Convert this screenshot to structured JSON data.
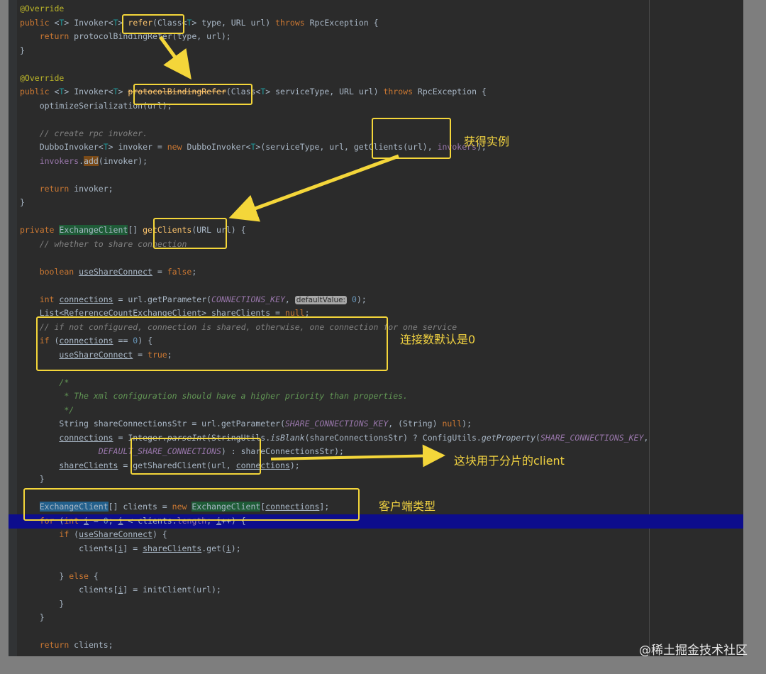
{
  "editor": {
    "lines": [
      [
        {
          "t": "@Override",
          "c": "ann"
        }
      ],
      [
        {
          "t": "public ",
          "c": "kw"
        },
        {
          "t": "<",
          "c": "p"
        },
        {
          "t": "T",
          "c": "tp"
        },
        {
          "t": "> Invoker<",
          "c": "type"
        },
        {
          "t": "T",
          "c": "tp"
        },
        {
          "t": "> ",
          "c": "p"
        },
        {
          "t": "refer",
          "c": "fn"
        },
        {
          "t": "(Class<",
          "c": "p"
        },
        {
          "t": "T",
          "c": "tp"
        },
        {
          "t": "> type, URL url) ",
          "c": "p"
        },
        {
          "t": "throws ",
          "c": "kw"
        },
        {
          "t": "RpcException {",
          "c": "p"
        }
      ],
      [
        {
          "t": "    ",
          "c": "p"
        },
        {
          "t": "return ",
          "c": "kw"
        },
        {
          "t": "protocolBindingRefer(type, url);",
          "c": "p"
        }
      ],
      [
        {
          "t": "}",
          "c": "p"
        }
      ],
      [
        {
          "t": "",
          "c": "p"
        }
      ],
      [
        {
          "t": "@Override",
          "c": "ann"
        }
      ],
      [
        {
          "t": "public ",
          "c": "kw"
        },
        {
          "t": "<",
          "c": "p"
        },
        {
          "t": "T",
          "c": "tp"
        },
        {
          "t": "> Invoker<",
          "c": "type"
        },
        {
          "t": "T",
          "c": "tp"
        },
        {
          "t": "> ",
          "c": "p"
        },
        {
          "t": "protocolBindingRefer",
          "c": "strike"
        },
        {
          "t": "(Class<",
          "c": "p"
        },
        {
          "t": "T",
          "c": "tp"
        },
        {
          "t": "> serviceType, URL url) ",
          "c": "p"
        },
        {
          "t": "throws ",
          "c": "kw"
        },
        {
          "t": "RpcException {",
          "c": "p"
        }
      ],
      [
        {
          "t": "    optimizeSerialization(url);",
          "c": "p"
        }
      ],
      [
        {
          "t": "",
          "c": "p"
        }
      ],
      [
        {
          "t": "    ",
          "c": "p"
        },
        {
          "t": "// create rpc invoker.",
          "c": "cm"
        }
      ],
      [
        {
          "t": "    DubboInvoker<",
          "c": "p"
        },
        {
          "t": "T",
          "c": "tp"
        },
        {
          "t": "> invoker = ",
          "c": "p"
        },
        {
          "t": "new ",
          "c": "kw"
        },
        {
          "t": "DubboInvoker<",
          "c": "p"
        },
        {
          "t": "T",
          "c": "tp"
        },
        {
          "t": ">(serviceType, url, getClients(url), ",
          "c": "p"
        },
        {
          "t": "invokers",
          "c": "field"
        },
        {
          "t": ");",
          "c": "p"
        }
      ],
      [
        {
          "t": "    ",
          "c": "p"
        },
        {
          "t": "invokers",
          "c": "field"
        },
        {
          "t": ".",
          "c": "p"
        },
        {
          "t": "add",
          "c": "mark"
        },
        {
          "t": "(invoker);",
          "c": "p"
        }
      ],
      [
        {
          "t": "",
          "c": "p"
        }
      ],
      [
        {
          "t": "    ",
          "c": "p"
        },
        {
          "t": "return ",
          "c": "kw"
        },
        {
          "t": "invoker;",
          "c": "p"
        }
      ],
      [
        {
          "t": "}",
          "c": "p"
        }
      ],
      [
        {
          "t": "",
          "c": "p"
        }
      ],
      [
        {
          "t": "private ",
          "c": "kw"
        },
        {
          "t": "ExchangeClient",
          "c": "hl"
        },
        {
          "t": "[] ",
          "c": "p"
        },
        {
          "t": "getClients",
          "c": "fn"
        },
        {
          "t": "(URL url) {",
          "c": "p"
        }
      ],
      [
        {
          "t": "    ",
          "c": "p"
        },
        {
          "t": "// whether to share connection",
          "c": "cm"
        }
      ],
      [
        {
          "t": "",
          "c": "p"
        }
      ],
      [
        {
          "t": "    ",
          "c": "p"
        },
        {
          "t": "boolean ",
          "c": "kw"
        },
        {
          "t": "useShareConnect",
          "c": "ul"
        },
        {
          "t": " = ",
          "c": "p"
        },
        {
          "t": "false",
          "c": "kw"
        },
        {
          "t": ";",
          "c": "p"
        }
      ],
      [
        {
          "t": "",
          "c": "p"
        }
      ],
      [
        {
          "t": "    ",
          "c": "p"
        },
        {
          "t": "int ",
          "c": "kw"
        },
        {
          "t": "connections",
          "c": "ul"
        },
        {
          "t": " = url.getParameter(",
          "c": "p"
        },
        {
          "t": "CONNECTIONS_KEY",
          "c": "const"
        },
        {
          "t": ", ",
          "c": "p"
        },
        {
          "t": "defaultValue:",
          "c": "hint"
        },
        {
          "t": " ",
          "c": "p"
        },
        {
          "t": "0",
          "c": "num"
        },
        {
          "t": ");",
          "c": "p"
        }
      ],
      [
        {
          "t": "    List<ReferenceCountExchangeClient> ",
          "c": "p"
        },
        {
          "t": "shareClients",
          "c": "ul"
        },
        {
          "t": " = ",
          "c": "p"
        },
        {
          "t": "null",
          "c": "kw"
        },
        {
          "t": ";",
          "c": "p"
        }
      ],
      [
        {
          "t": "    ",
          "c": "p"
        },
        {
          "t": "// if not configured, connection is shared, otherwise, one connection for one service",
          "c": "cm"
        }
      ],
      [
        {
          "t": "    ",
          "c": "p"
        },
        {
          "t": "if ",
          "c": "kw"
        },
        {
          "t": "(",
          "c": "p"
        },
        {
          "t": "connections",
          "c": "ul"
        },
        {
          "t": " == ",
          "c": "p"
        },
        {
          "t": "0",
          "c": "num"
        },
        {
          "t": ") {",
          "c": "p"
        }
      ],
      [
        {
          "t": "        ",
          "c": "p"
        },
        {
          "t": "useShareConnect",
          "c": "ul"
        },
        {
          "t": " = ",
          "c": "p"
        },
        {
          "t": "true",
          "c": "kw"
        },
        {
          "t": ";",
          "c": "p"
        }
      ],
      [
        {
          "t": "",
          "c": "p"
        }
      ],
      [
        {
          "t": "        ",
          "c": "p"
        },
        {
          "t": "/*",
          "c": "cmb"
        }
      ],
      [
        {
          "t": "         ",
          "c": "p"
        },
        {
          "t": "* The xml configuration should have a higher priority than properties.",
          "c": "cmb"
        }
      ],
      [
        {
          "t": "         ",
          "c": "p"
        },
        {
          "t": "*/",
          "c": "cmb"
        }
      ],
      [
        {
          "t": "        String shareConnectionsStr = url.getParameter(",
          "c": "p"
        },
        {
          "t": "SHARE_CONNECTIONS_KEY",
          "c": "const"
        },
        {
          "t": ", (String) ",
          "c": "p"
        },
        {
          "t": "null",
          "c": "kw"
        },
        {
          "t": ");",
          "c": "p"
        }
      ],
      [
        {
          "t": "        ",
          "c": "p"
        },
        {
          "t": "connections",
          "c": "ul"
        },
        {
          "t": " = Integer.",
          "c": "p"
        },
        {
          "t": "parseInt",
          "c": "st"
        },
        {
          "t": "(StringUtils.",
          "c": "p"
        },
        {
          "t": "isBlank",
          "c": "st"
        },
        {
          "t": "(shareConnectionsStr) ? ConfigUtils.",
          "c": "p"
        },
        {
          "t": "getProperty",
          "c": "st"
        },
        {
          "t": "(",
          "c": "p"
        },
        {
          "t": "SHARE_CONNECTIONS_KEY",
          "c": "const"
        },
        {
          "t": ",",
          "c": "p"
        }
      ],
      [
        {
          "t": "                ",
          "c": "p"
        },
        {
          "t": "DEFAULT_SHARE_CONNECTIONS",
          "c": "const"
        },
        {
          "t": ") : shareConnectionsStr);",
          "c": "p"
        }
      ],
      [
        {
          "t": "        ",
          "c": "p"
        },
        {
          "t": "shareClients",
          "c": "ul"
        },
        {
          "t": " = getSharedClient(url, ",
          "c": "p"
        },
        {
          "t": "connections",
          "c": "ul"
        },
        {
          "t": ");",
          "c": "p"
        }
      ],
      [
        {
          "t": "    }",
          "c": "p"
        }
      ],
      [
        {
          "t": "",
          "c": "p"
        }
      ],
      [
        {
          "t": "    ",
          "c": "p"
        },
        {
          "t": "ExchangeClient",
          "c": "hl2"
        },
        {
          "t": "[] clients = ",
          "c": "p"
        },
        {
          "t": "new ",
          "c": "kw"
        },
        {
          "t": "ExchangeClient",
          "c": "hl"
        },
        {
          "t": "[",
          "c": "p"
        },
        {
          "t": "connections",
          "c": "ul"
        },
        {
          "t": "];",
          "c": "p"
        }
      ],
      [
        {
          "t": "    ",
          "c": "p"
        },
        {
          "t": "for ",
          "c": "kw"
        },
        {
          "t": "(",
          "c": "p"
        },
        {
          "t": "int ",
          "c": "kw"
        },
        {
          "t": "i",
          "c": "ul"
        },
        {
          "t": " = ",
          "c": "p"
        },
        {
          "t": "0",
          "c": "num"
        },
        {
          "t": "; ",
          "c": "p"
        },
        {
          "t": "i",
          "c": "ul"
        },
        {
          "t": " < clients.",
          "c": "p"
        },
        {
          "t": "length",
          "c": "field"
        },
        {
          "t": "; ",
          "c": "p"
        },
        {
          "t": "i",
          "c": "ul"
        },
        {
          "t": "++) {",
          "c": "p"
        }
      ],
      [
        {
          "t": "        ",
          "c": "p"
        },
        {
          "t": "if ",
          "c": "kw"
        },
        {
          "t": "(",
          "c": "p"
        },
        {
          "t": "useShareConnect",
          "c": "ul"
        },
        {
          "t": ") {",
          "c": "p"
        }
      ],
      [
        {
          "t": "            clients[",
          "c": "p"
        },
        {
          "t": "i",
          "c": "ul"
        },
        {
          "t": "] = ",
          "c": "p"
        },
        {
          "t": "shareClients",
          "c": "ul"
        },
        {
          "t": ".get(",
          "c": "p"
        },
        {
          "t": "i",
          "c": "ul"
        },
        {
          "t": ");",
          "c": "p"
        }
      ],
      [
        {
          "t": "",
          "c": "p"
        }
      ],
      [
        {
          "t": "        } ",
          "c": "p"
        },
        {
          "t": "else ",
          "c": "kw"
        },
        {
          "t": "{",
          "c": "p"
        }
      ],
      [
        {
          "t": "            clients[",
          "c": "p"
        },
        {
          "t": "i",
          "c": "ul"
        },
        {
          "t": "] = initClient(url);",
          "c": "p"
        }
      ],
      [
        {
          "t": "        }",
          "c": "p"
        }
      ],
      [
        {
          "t": "    }",
          "c": "p"
        }
      ],
      [
        {
          "t": "",
          "c": "p"
        }
      ],
      [
        {
          "t": "    ",
          "c": "p"
        },
        {
          "t": "return ",
          "c": "kw"
        },
        {
          "t": "clients;",
          "c": "p"
        }
      ]
    ],
    "highlighted_line": 37
  },
  "annotations": {
    "get_instance": "获得实例",
    "default_connections": "连接数默认是0",
    "sharded_client": "这块用于分片的client",
    "client_type": "客户端类型"
  },
  "watermark": "@稀土掘金技术社区",
  "colors": {
    "editor_bg": "#2b2b2b",
    "accent_yellow": "#f4d63a",
    "selection_blue": "#0d0d8c"
  }
}
